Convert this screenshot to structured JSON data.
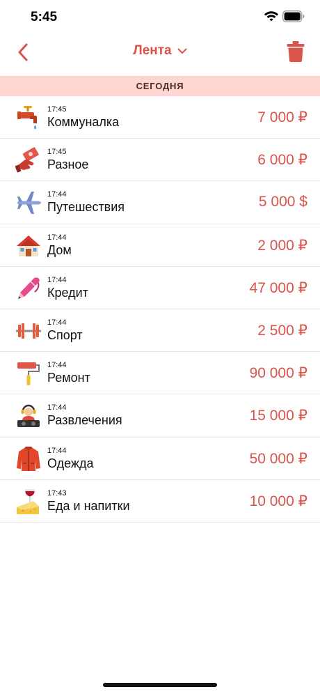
{
  "status_bar": {
    "time": "5:45"
  },
  "nav": {
    "title": "Лента"
  },
  "section": {
    "label": "СЕГОДНЯ"
  },
  "colors": {
    "accent": "#d9544a",
    "section_bg": "#fdd6d2"
  },
  "transactions": [
    {
      "time": "17:45",
      "category": "Коммуналка",
      "amount": "7 000 ₽",
      "icon": "faucet-icon"
    },
    {
      "time": "17:45",
      "category": "Разное",
      "amount": "6 000 ₽",
      "icon": "money-hand-icon"
    },
    {
      "time": "17:44",
      "category": "Путешествия",
      "amount": "5 000 $",
      "icon": "airplane-icon"
    },
    {
      "time": "17:44",
      "category": "Дом",
      "amount": "2 000 ₽",
      "icon": "house-icon"
    },
    {
      "time": "17:44",
      "category": "Кредит",
      "amount": "47 000 ₽",
      "icon": "pen-icon"
    },
    {
      "time": "17:44",
      "category": "Спорт",
      "amount": "2 500 ₽",
      "icon": "dumbbell-icon"
    },
    {
      "time": "17:44",
      "category": "Ремонт",
      "amount": "90 000 ₽",
      "icon": "paint-roller-icon"
    },
    {
      "time": "17:44",
      "category": "Развлечения",
      "amount": "15 000 ₽",
      "icon": "dj-icon"
    },
    {
      "time": "17:44",
      "category": "Одежда",
      "amount": "50 000 ₽",
      "icon": "jacket-icon"
    },
    {
      "time": "17:43",
      "category": "Еда и напитки",
      "amount": "10 000 ₽",
      "icon": "wine-cheese-icon"
    }
  ]
}
